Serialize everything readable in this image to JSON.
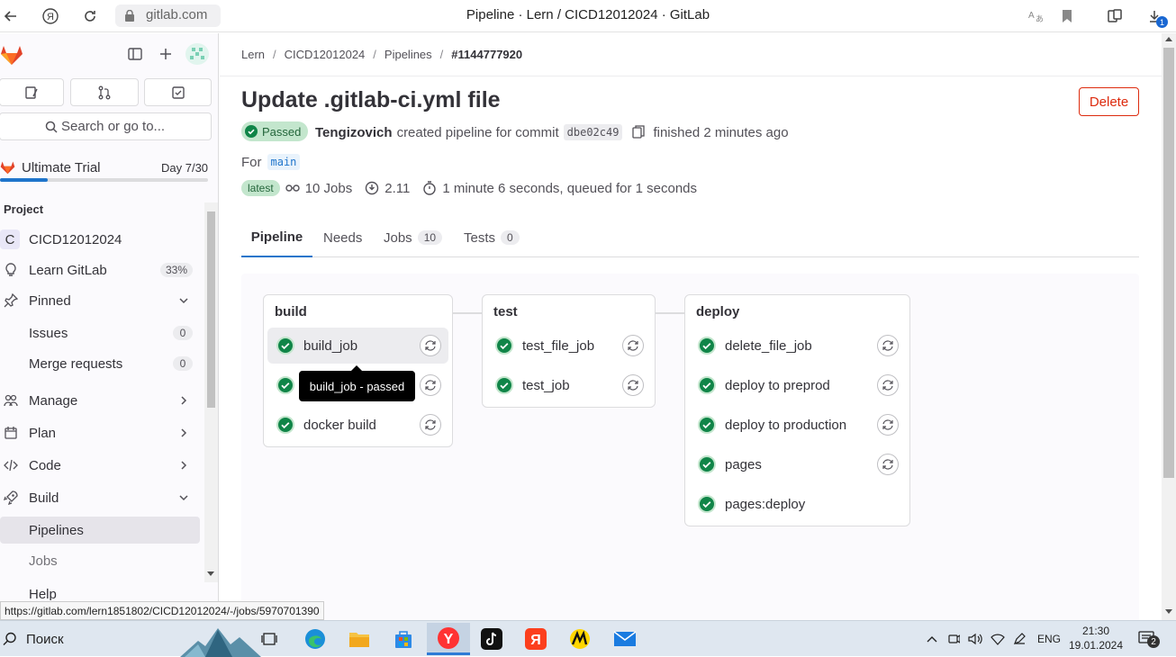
{
  "browser": {
    "url_domain": "gitlab.com",
    "tab_title": "Pipeline · Lern / CICD12012024 · GitLab",
    "downloads_badge": "1"
  },
  "sidebar": {
    "search_placeholder": "Search or go to...",
    "trial": {
      "label": "Ultimate Trial",
      "day": "Day 7/30",
      "progress": 0.23
    },
    "section_title": "Project",
    "project": {
      "avatar_letter": "C",
      "name": "CICD12012024"
    },
    "items": [
      {
        "label": "Learn GitLab",
        "badge": "33%"
      },
      {
        "label": "Pinned"
      },
      {
        "label": "Issues",
        "count": "0"
      },
      {
        "label": "Merge requests",
        "count": "0"
      },
      {
        "label": "Manage"
      },
      {
        "label": "Plan"
      },
      {
        "label": "Code"
      },
      {
        "label": "Build"
      },
      {
        "label": "Pipelines"
      },
      {
        "label": "Jobs"
      },
      {
        "label": "Help"
      }
    ]
  },
  "breadcrumb": [
    "Lern",
    "CICD12012024",
    "Pipelines",
    "#1144777920"
  ],
  "pipeline": {
    "title": "Update .gitlab-ci.yml file",
    "delete_label": "Delete",
    "status": "Passed",
    "author": "Tengizovich",
    "created_text": "created pipeline for commit",
    "commit": "dbe02c49",
    "finished": "finished 2 minutes ago",
    "for_label": "For",
    "ref": "main",
    "latest_badge": "latest",
    "jobs_count": "10 Jobs",
    "compute": "2.11",
    "duration": "1 minute 6 seconds, queued for 1 seconds"
  },
  "tabs": [
    {
      "label": "Pipeline",
      "active": true
    },
    {
      "label": "Needs"
    },
    {
      "label": "Jobs",
      "count": "10"
    },
    {
      "label": "Tests",
      "count": "0"
    }
  ],
  "stages": [
    {
      "name": "build",
      "jobs": [
        "build_job",
        "",
        "docker build"
      ]
    },
    {
      "name": "test",
      "jobs": [
        "test_file_job",
        "test_job"
      ]
    },
    {
      "name": "deploy",
      "jobs": [
        "delete_file_job",
        "deploy to preprod",
        "deploy to production",
        "pages",
        "pages:deploy"
      ]
    }
  ],
  "tooltip": "build_job - passed",
  "status_url": "https://gitlab.com/lern1851802/CICD12012024/-/jobs/5970701390",
  "taskbar": {
    "search_label": "Поиск",
    "lang": "ENG",
    "time": "21:30",
    "date": "19.01.2024",
    "notifications": "2"
  },
  "colors": {
    "success": "#108548",
    "delete": "#dd2b0e",
    "tab_active": "#1f75cb"
  }
}
